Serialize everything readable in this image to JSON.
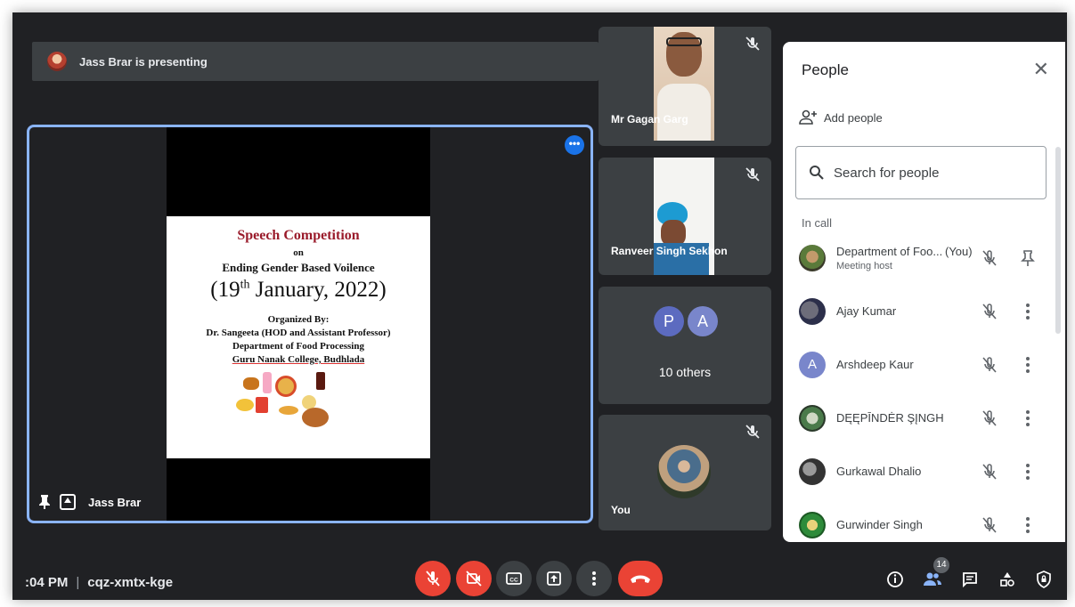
{
  "banner": {
    "text": "Jass Brar is presenting"
  },
  "main_tile": {
    "presenter_name": "Jass Brar",
    "slide": {
      "title": "Speech Competition",
      "on": "on",
      "topic": "Ending Gender Based Voilence",
      "date_day": "(19",
      "date_sup": "th",
      "date_rest": " January, 2022)",
      "organized_by": "Organized By:",
      "organizer": "Dr. Sangeeta (HOD and Assistant Professor)",
      "department": "Department of Food Processing",
      "college": "Guru Nanak College, Budhlada"
    }
  },
  "side_tiles": [
    {
      "name": "Mr Gagan Garg",
      "muted": true
    },
    {
      "name": "Ranveer Singh Sekhon",
      "muted": true
    },
    {
      "avatars": [
        "P",
        "A"
      ],
      "label": "10 others"
    },
    {
      "name": "You",
      "muted": true
    }
  ],
  "people_panel": {
    "title": "People",
    "add_people": "Add people",
    "search_placeholder": "Search for people",
    "section_label": "In call",
    "participants": [
      {
        "name": "Department of Foo...",
        "tag": "(You)",
        "subtitle": "Meeting host"
      },
      {
        "name": "Ajay Kumar"
      },
      {
        "name": "Arshdeep Kaur",
        "initial": "A"
      },
      {
        "name": "DĘĘPĪNDĖR ŞĮNGH"
      },
      {
        "name": "Gurkawal Dhalio"
      },
      {
        "name": "Gurwinder Singh"
      }
    ]
  },
  "bottom_bar": {
    "time": ":04 PM",
    "separator": "|",
    "meeting_code": "cqz-xmtx-kge",
    "participant_count": "14"
  },
  "colors": {
    "background": "#202124",
    "tile": "#3c4043",
    "accent_blue": "#8ab4f8",
    "red": "#ea4335",
    "avatar_p": "#5c6bc0",
    "avatar_a": "#7986cb"
  }
}
